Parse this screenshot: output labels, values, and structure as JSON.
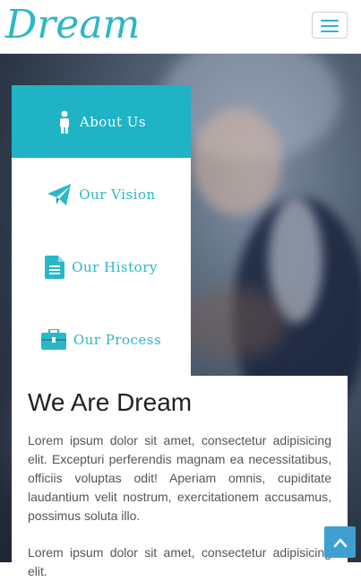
{
  "header": {
    "logo_text": "Dream"
  },
  "tabs": [
    {
      "label": "About Us",
      "icon": "person-icon"
    },
    {
      "label": "Our Vision",
      "icon": "paper-plane-icon"
    },
    {
      "label": "Our History",
      "icon": "document-icon"
    },
    {
      "label": "Our Process",
      "icon": "briefcase-icon"
    }
  ],
  "content": {
    "title": "We Are Dream",
    "paragraph1": "Lorem ipsum dolor sit amet, consectetur adipisicing elit. Excepturi perferendis magnam ea necessitatibus, officiis voluptas odit! Aperiam omnis, cupiditate laudantium velit nostrum, exercitationem accusamus, possimus soluta illo.",
    "paragraph2": "Lorem ipsum dolor sit amet, consectetur adipisicing elit."
  },
  "colors": {
    "accent": "#2bb7c7",
    "active_tab": "#1fb3c5",
    "scroll_top": "#3f9fd1"
  }
}
